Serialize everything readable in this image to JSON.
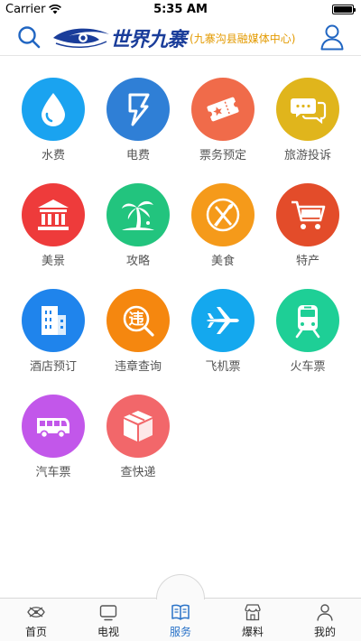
{
  "status_bar": {
    "carrier": "Carrier",
    "time": "5:35 AM",
    "battery_level": 1.0
  },
  "header": {
    "logo_text": "世界九寨",
    "logo_sub": "(九寨沟县融媒体中心)"
  },
  "services": [
    {
      "label": "水费",
      "icon": "water-drop-icon",
      "color": "#1aa3f0"
    },
    {
      "label": "电费",
      "icon": "lightning-icon",
      "color": "#2f7fd6"
    },
    {
      "label": "票务预定",
      "icon": "ticket-icon",
      "color": "#f06b4a"
    },
    {
      "label": "旅游投诉",
      "icon": "chat-bubbles-icon",
      "color": "#e0b51c"
    },
    {
      "label": "美景",
      "icon": "landmark-icon",
      "color": "#ee3b3b"
    },
    {
      "label": "攻略",
      "icon": "palm-tree-icon",
      "color": "#22c47e"
    },
    {
      "label": "美食",
      "icon": "fork-knife-icon",
      "color": "#f59a1a"
    },
    {
      "label": "特产",
      "icon": "shopping-cart-icon",
      "color": "#e34c2a"
    },
    {
      "label": "酒店预订",
      "icon": "hotel-building-icon",
      "color": "#1f84ec"
    },
    {
      "label": "违章查询",
      "icon": "violation-search-icon",
      "color": "#f5870f"
    },
    {
      "label": "飞机票",
      "icon": "airplane-icon",
      "color": "#14a8ee"
    },
    {
      "label": "火车票",
      "icon": "train-icon",
      "color": "#1ecf96"
    },
    {
      "label": "汽车票",
      "icon": "bus-icon",
      "color": "#c257ea"
    },
    {
      "label": "查快递",
      "icon": "package-icon",
      "color": "#f2676a"
    }
  ],
  "tabbar": {
    "tabs": [
      {
        "label": "首页",
        "icon": "home-logo-icon"
      },
      {
        "label": "电视",
        "icon": "tv-icon"
      },
      {
        "label": "服务",
        "icon": "book-icon",
        "active": true
      },
      {
        "label": "爆料",
        "icon": "shop-icon"
      },
      {
        "label": "我的",
        "icon": "person-icon"
      }
    ],
    "active_color": "#2a73c8"
  }
}
